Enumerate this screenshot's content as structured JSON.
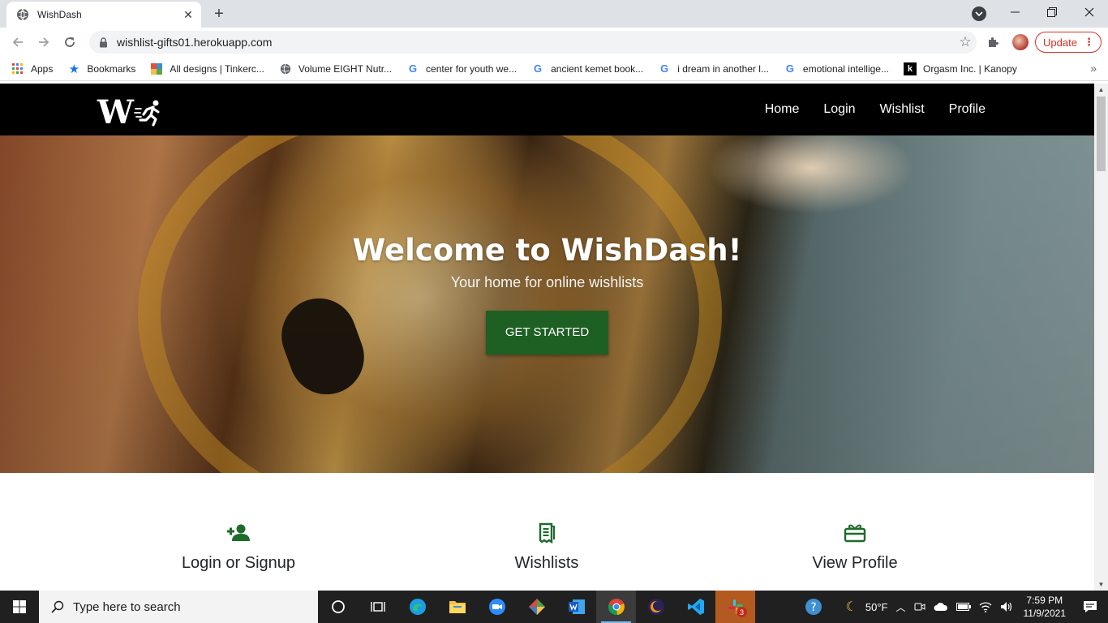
{
  "browser": {
    "tab_title": "WishDash",
    "url": "wishlist-gifts01.herokuapp.com",
    "update_label": "Update",
    "colors": {
      "accent_red": "#d93025"
    }
  },
  "bookmarks": [
    {
      "label": "Apps",
      "icon": "apps-grid-icon"
    },
    {
      "label": "Bookmarks",
      "icon": "star-icon"
    },
    {
      "label": "All designs | Tinkerc...",
      "icon": "tinkercad-icon"
    },
    {
      "label": "Volume EIGHT Nutr...",
      "icon": "globe-icon"
    },
    {
      "label": "center for youth we...",
      "icon": "google-icon"
    },
    {
      "label": "ancient kemet book...",
      "icon": "google-icon"
    },
    {
      "label": "i dream in another l...",
      "icon": "google-icon"
    },
    {
      "label": "emotional intellige...",
      "icon": "google-icon"
    },
    {
      "label": "Orgasm Inc. | Kanopy",
      "icon": "kanopy-icon"
    }
  ],
  "site": {
    "nav": [
      "Home",
      "Login",
      "Wishlist",
      "Profile"
    ],
    "hero": {
      "title": "Welcome to WishDash!",
      "subtitle": "Your home for online wishlists",
      "cta": "GET STARTED"
    },
    "features": [
      {
        "title": "Login or Signup",
        "icon": "add-user-icon"
      },
      {
        "title": "Wishlists",
        "icon": "list-receipt-icon"
      },
      {
        "title": "View Profile",
        "icon": "gift-card-icon"
      }
    ],
    "colors": {
      "brand_green": "#1e5f23",
      "nav_black": "#000000"
    }
  },
  "taskbar": {
    "search_placeholder": "Type here to search",
    "weather": "50°F",
    "time": "7:59 PM",
    "date": "11/9/2021",
    "notification_count": "3"
  }
}
